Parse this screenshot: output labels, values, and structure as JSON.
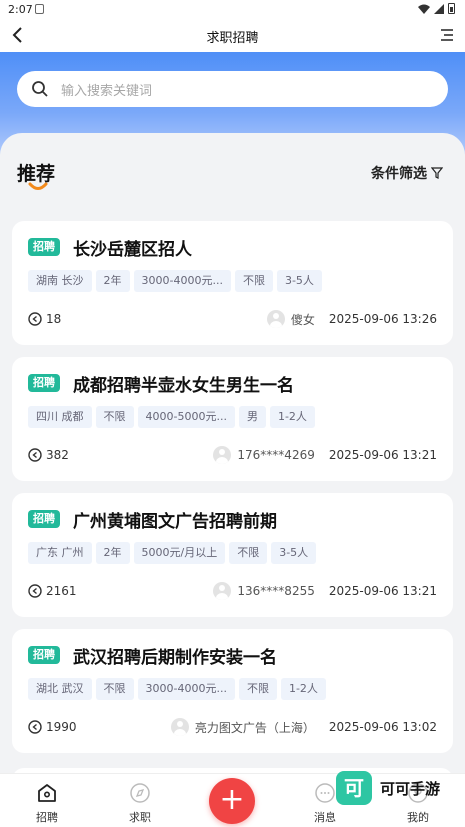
{
  "status_bar": {
    "time": "2:07"
  },
  "nav": {
    "title": "求职招聘"
  },
  "search": {
    "placeholder": "输入搜索关键词"
  },
  "section": {
    "title": "推荐",
    "filter_label": "条件筛选"
  },
  "jobs": [
    {
      "badge": "招聘",
      "title": "长沙岳麓区招人",
      "tags": [
        "湖南 长沙",
        "2年",
        "3000-4000元...",
        "不限",
        "3-5人"
      ],
      "views": "18",
      "poster": "傻女",
      "time": "2025-09-06 13:26"
    },
    {
      "badge": "招聘",
      "title": "成都招聘半壶水女生男生一名",
      "tags": [
        "四川 成都",
        "不限",
        "4000-5000元...",
        "男",
        "1-2人"
      ],
      "views": "382",
      "poster": "176****4269",
      "time": "2025-09-06 13:21"
    },
    {
      "badge": "招聘",
      "title": "广州黄埔图文广告招聘前期",
      "tags": [
        "广东 广州",
        "2年",
        "5000元/月以上",
        "不限",
        "3-5人"
      ],
      "views": "2161",
      "poster": "136****8255",
      "time": "2025-09-06 13:21"
    },
    {
      "badge": "招聘",
      "title": "武汉招聘后期制作安装一名",
      "tags": [
        "湖北 武汉",
        "不限",
        "3000-4000元...",
        "不限",
        "1-2人"
      ],
      "views": "1990",
      "poster": "亮力图文广告（上海）",
      "time": "2025-09-06 13:02"
    }
  ],
  "tabbar": {
    "tab1": "招聘",
    "tab2": "求职",
    "tab4": "消息",
    "tab5": "我的",
    "fab": "+"
  },
  "watermark": {
    "logo": "可",
    "text": "可可手游"
  },
  "colors": {
    "accent": "#4f8ff7",
    "badge": "#22b99a",
    "fab": "#f04444"
  }
}
